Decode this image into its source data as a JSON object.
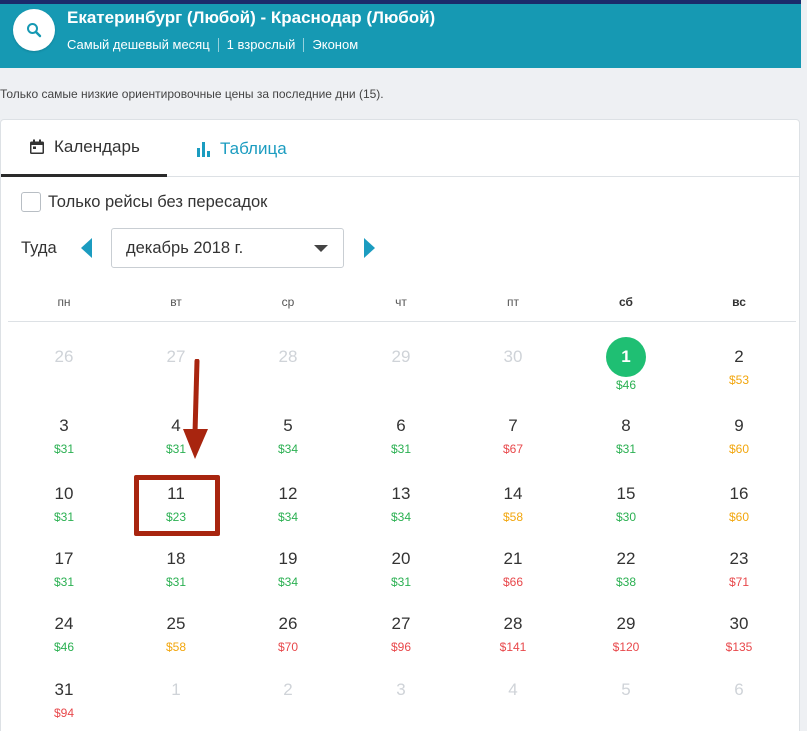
{
  "header": {
    "title": "Екатеринбург (Любой) - Краснодар (Любой)",
    "period": "Самый дешевый месяц",
    "passengers": "1 взрослый",
    "cabin": "Эконом"
  },
  "disclaimer": "Только самые низкие ориентировочные цены за последние дни (15).",
  "tabs": {
    "calendar": "Календарь",
    "table": "Таблица"
  },
  "direct_only_label": "Только рейсы без пересадок",
  "direction_label": "Туда",
  "month_selected": "декабрь 2018 г.",
  "weekdays": [
    "пн",
    "вт",
    "ср",
    "чт",
    "пт",
    "сб",
    "вс"
  ],
  "colors": {
    "green": "#2bb052",
    "yellow": "#f2a60d",
    "red": "#e8484b",
    "brand": "#1699b3",
    "annotation": "#a8250f"
  },
  "weeks": [
    [
      {
        "day": "26",
        "other": true
      },
      {
        "day": "27",
        "other": true
      },
      {
        "day": "28",
        "other": true
      },
      {
        "day": "29",
        "other": true
      },
      {
        "day": "30",
        "other": true
      },
      {
        "day": "1",
        "price": "$46",
        "level": "green",
        "selected": true
      },
      {
        "day": "2",
        "price": "$53",
        "level": "yellow"
      }
    ],
    [
      {
        "day": "3",
        "price": "$31",
        "level": "green"
      },
      {
        "day": "4",
        "price": "$31",
        "level": "green"
      },
      {
        "day": "5",
        "price": "$34",
        "level": "green"
      },
      {
        "day": "6",
        "price": "$31",
        "level": "green"
      },
      {
        "day": "7",
        "price": "$67",
        "level": "red"
      },
      {
        "day": "8",
        "price": "$31",
        "level": "green"
      },
      {
        "day": "9",
        "price": "$60",
        "level": "yellow"
      }
    ],
    [
      {
        "day": "10",
        "price": "$31",
        "level": "green"
      },
      {
        "day": "11",
        "price": "$23",
        "level": "green"
      },
      {
        "day": "12",
        "price": "$34",
        "level": "green"
      },
      {
        "day": "13",
        "price": "$34",
        "level": "green"
      },
      {
        "day": "14",
        "price": "$58",
        "level": "yellow"
      },
      {
        "day": "15",
        "price": "$30",
        "level": "green"
      },
      {
        "day": "16",
        "price": "$60",
        "level": "yellow"
      }
    ],
    [
      {
        "day": "17",
        "price": "$31",
        "level": "green"
      },
      {
        "day": "18",
        "price": "$31",
        "level": "green"
      },
      {
        "day": "19",
        "price": "$34",
        "level": "green"
      },
      {
        "day": "20",
        "price": "$31",
        "level": "green"
      },
      {
        "day": "21",
        "price": "$66",
        "level": "red"
      },
      {
        "day": "22",
        "price": "$38",
        "level": "green"
      },
      {
        "day": "23",
        "price": "$71",
        "level": "red"
      }
    ],
    [
      {
        "day": "24",
        "price": "$46",
        "level": "green"
      },
      {
        "day": "25",
        "price": "$58",
        "level": "yellow"
      },
      {
        "day": "26",
        "price": "$70",
        "level": "red"
      },
      {
        "day": "27",
        "price": "$96",
        "level": "red"
      },
      {
        "day": "28",
        "price": "$141",
        "level": "red"
      },
      {
        "day": "29",
        "price": "$120",
        "level": "red"
      },
      {
        "day": "30",
        "price": "$135",
        "level": "red"
      }
    ],
    [
      {
        "day": "31",
        "price": "$94",
        "level": "red"
      },
      {
        "day": "1",
        "other": true
      },
      {
        "day": "2",
        "other": true
      },
      {
        "day": "3",
        "other": true
      },
      {
        "day": "4",
        "other": true
      },
      {
        "day": "5",
        "other": true
      },
      {
        "day": "6",
        "other": true
      }
    ]
  ]
}
